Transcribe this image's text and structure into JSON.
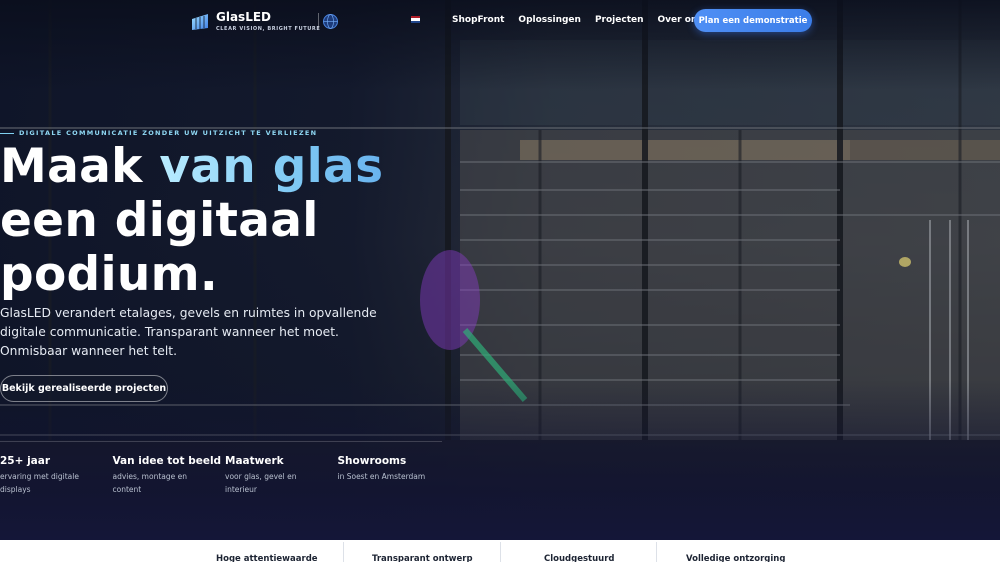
{
  "nav": {
    "logo_name": "GlasLED",
    "logo_tagline": "CLEAR VISION, BRIGHT FUTURE",
    "links": [
      "ShopFront",
      "Oplossingen",
      "Projecten",
      "Over ons"
    ],
    "cta": "Plan een demonstratie",
    "language_flag": "nl-flag-icon",
    "globe_icon": "globe-icon"
  },
  "hero": {
    "eyebrow": "DIGITALE COMMUNICATIE ZONDER UW UITZICHT TE VERLIEZEN",
    "headline_part1": "Maak ",
    "headline_accent": "van glas",
    "headline_part2": "een digitaal podium.",
    "lead": "GlasLED verandert etalages, gevels en ruimtes in opvallende digitale communicatie. Transparant wanneer het moet. Onmisbaar wanneer het telt.",
    "secondary_button": "Bekijk gerealiseerde projecten"
  },
  "stats": [
    {
      "title": "25+ jaar",
      "desc": "ervaring met digitale displays"
    },
    {
      "title": "Van idee tot beeld",
      "desc": "advies, montage en content"
    },
    {
      "title": "Maatwerk",
      "desc": "voor glas, gevel en interieur"
    },
    {
      "title": "Showrooms",
      "desc": "in Soest en Amsterdam"
    }
  ],
  "features": [
    "Hoge attentiewaarde",
    "Transparant ontwerp",
    "Cloudgestuurd",
    "Volledige ontzorging"
  ],
  "colors": {
    "accent_blue": "#3b7de8",
    "accent_light": "#8fd8f4",
    "background_dark": "#0c1220"
  }
}
